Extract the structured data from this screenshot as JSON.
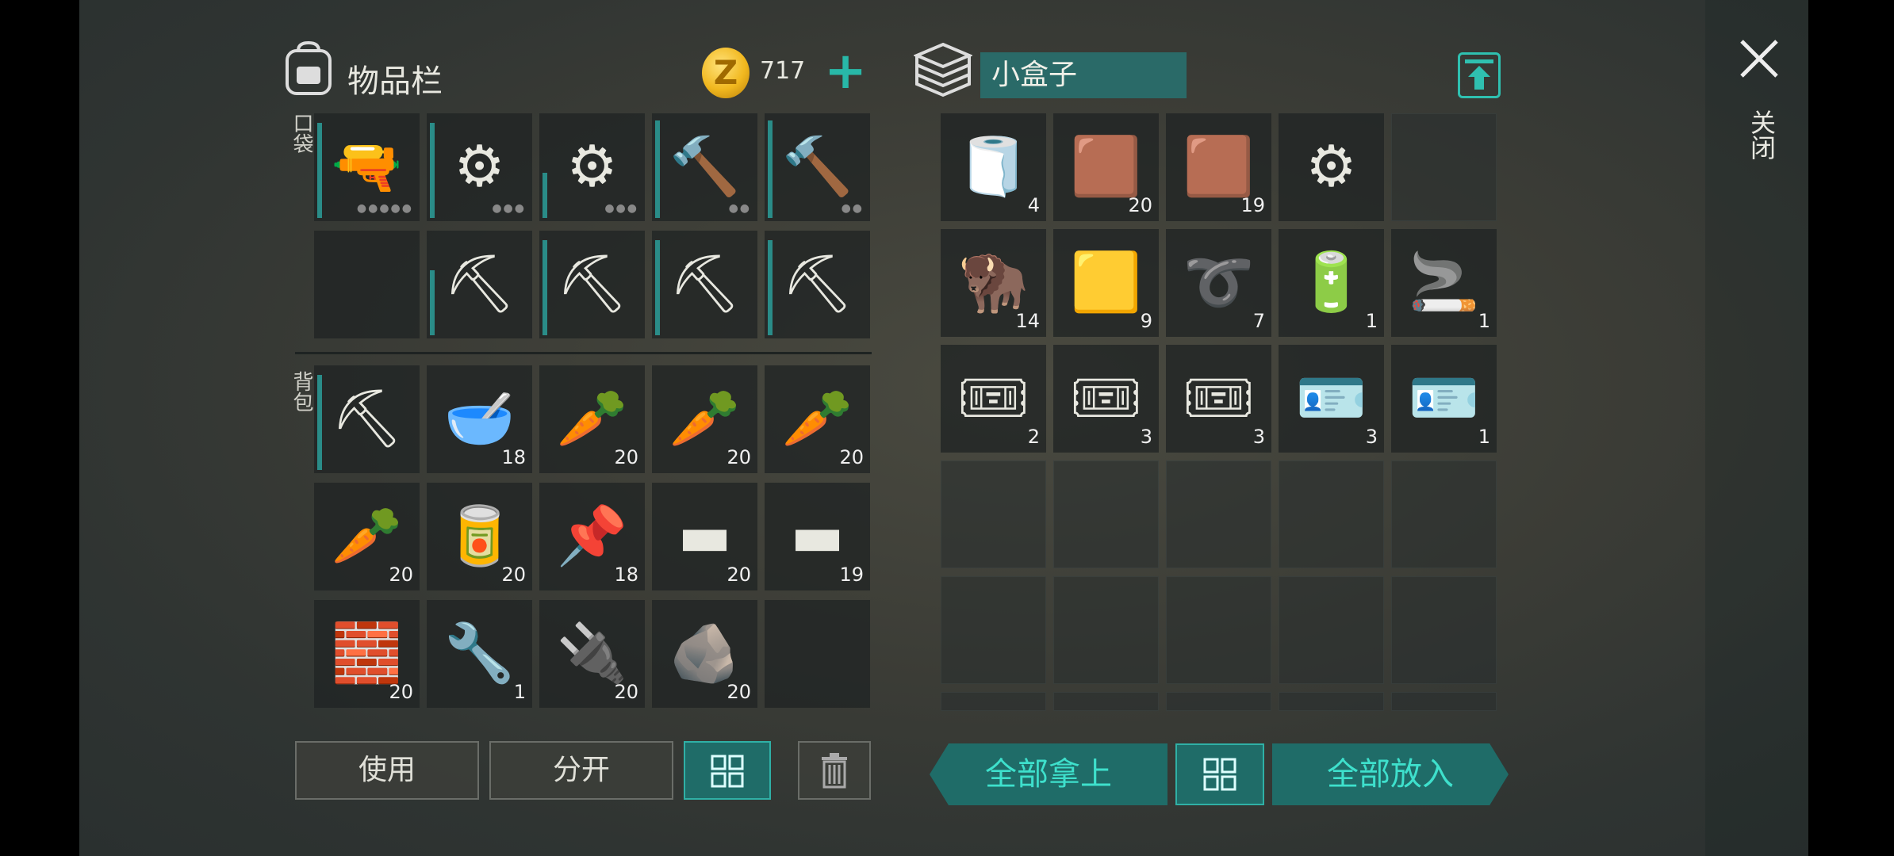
{
  "inventory": {
    "title": "物品栏",
    "coins": "717",
    "pocket_label": "口袋",
    "backpack_label": "背包",
    "pocket_slots": [
      {
        "item": "pistol",
        "icon": "pistol-icon",
        "glyph": "🔫",
        "count": "",
        "durability": 0.95,
        "dots": "●●●●●"
      },
      {
        "item": "saw mace",
        "icon": "saw-mace-icon",
        "glyph": "⚙",
        "count": "",
        "durability": 0.95,
        "dots": "●●●"
      },
      {
        "item": "saw mace",
        "icon": "saw-mace-icon",
        "glyph": "⚙",
        "count": "",
        "durability": 0.45,
        "dots": "●●●"
      },
      {
        "item": "sledgehammer",
        "icon": "hammer-icon",
        "glyph": "🔨",
        "count": "",
        "durability": 0.98,
        "dots": "●●"
      },
      {
        "item": "sledgehammer",
        "icon": "hammer-icon",
        "glyph": "🔨",
        "count": "",
        "durability": 0.98,
        "dots": "●●"
      },
      {
        "item": "",
        "icon": "",
        "glyph": "",
        "count": "",
        "durability": 0,
        "dots": ""
      },
      {
        "item": "pickaxe",
        "icon": "pickaxe-icon",
        "glyph": "⛏",
        "count": "",
        "durability": 0.65,
        "dots": ""
      },
      {
        "item": "pickaxe",
        "icon": "pickaxe-icon",
        "glyph": "⛏",
        "count": "",
        "durability": 0.95,
        "dots": ""
      },
      {
        "item": "pickaxe",
        "icon": "pickaxe-icon",
        "glyph": "⛏",
        "count": "",
        "durability": 0.95,
        "dots": ""
      },
      {
        "item": "pickaxe",
        "icon": "pickaxe-icon",
        "glyph": "⛏",
        "count": "",
        "durability": 0.95,
        "dots": ""
      }
    ],
    "backpack_slots": [
      {
        "item": "pickaxe",
        "icon": "pickaxe-icon",
        "glyph": "⛏",
        "count": "",
        "durability": 0.95,
        "dots": ""
      },
      {
        "item": "carrot stew",
        "icon": "stew-bowl-icon",
        "glyph": "🥣",
        "count": "18",
        "durability": 0,
        "dots": ""
      },
      {
        "item": "carrot",
        "icon": "carrot-icon",
        "glyph": "🥕",
        "count": "20",
        "durability": 0,
        "dots": ""
      },
      {
        "item": "carrot",
        "icon": "carrot-icon",
        "glyph": "🥕",
        "count": "20",
        "durability": 0,
        "dots": ""
      },
      {
        "item": "carrot",
        "icon": "carrot-icon",
        "glyph": "🥕",
        "count": "20",
        "durability": 0,
        "dots": ""
      },
      {
        "item": "carrot",
        "icon": "carrot-icon",
        "glyph": "🥕",
        "count": "20",
        "durability": 0,
        "dots": ""
      },
      {
        "item": "canned food",
        "icon": "canned-food-icon",
        "glyph": "🥫",
        "count": "20",
        "durability": 0,
        "dots": ""
      },
      {
        "item": "nails",
        "icon": "nails-icon",
        "glyph": "📌",
        "count": "18",
        "durability": 0,
        "dots": ""
      },
      {
        "item": "iron ingot",
        "icon": "iron-ingot-icon",
        "glyph": "▬",
        "count": "20",
        "durability": 0,
        "dots": ""
      },
      {
        "item": "iron ingot",
        "icon": "iron-ingot-icon",
        "glyph": "▬",
        "count": "19",
        "durability": 0,
        "dots": ""
      },
      {
        "item": "limestone",
        "icon": "limestone-icon",
        "glyph": "🧱",
        "count": "20",
        "durability": 0,
        "dots": ""
      },
      {
        "item": "wrench",
        "icon": "wrench-icon",
        "glyph": "🔧",
        "count": "1",
        "durability": 0,
        "dots": ""
      },
      {
        "item": "transistor",
        "icon": "transistor-icon",
        "glyph": "🔌",
        "count": "20",
        "durability": 0,
        "dots": ""
      },
      {
        "item": "stone",
        "icon": "stone-icon",
        "glyph": "🪨",
        "count": "20",
        "durability": 0,
        "dots": ""
      },
      {
        "item": "",
        "icon": "",
        "glyph": "",
        "count": "",
        "durability": 0,
        "dots": ""
      }
    ],
    "buttons": {
      "use": "使用",
      "split": "分开"
    }
  },
  "box": {
    "title": "小盒子",
    "slots": [
      {
        "item": "cloth",
        "icon": "cloth-icon",
        "glyph": "🧻",
        "count": "4"
      },
      {
        "item": "leather",
        "icon": "leather-icon",
        "glyph": "🟫",
        "count": "20"
      },
      {
        "item": "leather",
        "icon": "leather-icon",
        "glyph": "🟫",
        "count": "19"
      },
      {
        "item": "tire",
        "icon": "tire-icon",
        "glyph": "⚙",
        "count": ""
      },
      {
        "item": "",
        "icon": "",
        "glyph": "",
        "count": ""
      },
      {
        "item": "animal hide",
        "icon": "hide-icon",
        "glyph": "🦬",
        "count": "14"
      },
      {
        "item": "burlap",
        "icon": "burlap-icon",
        "glyph": "🟨",
        "count": "9"
      },
      {
        "item": "rope",
        "icon": "rope-icon",
        "glyph": "➰",
        "count": "7"
      },
      {
        "item": "batteries",
        "icon": "battery-icon",
        "glyph": "🔋",
        "count": "1"
      },
      {
        "item": "cigarettes",
        "icon": "cigarettes-icon",
        "glyph": "🚬",
        "count": "1"
      },
      {
        "item": "COMBAT GEAR COUPON",
        "icon": "coupon-icon",
        "glyph": "🎟",
        "count": "2"
      },
      {
        "item": "SURVIVAL KIT COUPON",
        "icon": "coupon-icon",
        "glyph": "🎟",
        "count": "3"
      },
      {
        "item": "RATION COUPON",
        "icon": "coupon-icon",
        "glyph": "🎟",
        "count": "3"
      },
      {
        "item": "US ARMY card C",
        "icon": "keycard-icon",
        "glyph": "🪪",
        "count": "3"
      },
      {
        "item": "US ARMY card R",
        "icon": "keycard-icon",
        "glyph": "🪪",
        "count": "1"
      }
    ],
    "buttons": {
      "take_all": "全部拿上",
      "put_all": "全部放入"
    }
  },
  "close_label": "关闭",
  "colors": {
    "accent": "#2fb0a6",
    "durability": "#2a8c88",
    "button_teal": "#1f6c68"
  }
}
